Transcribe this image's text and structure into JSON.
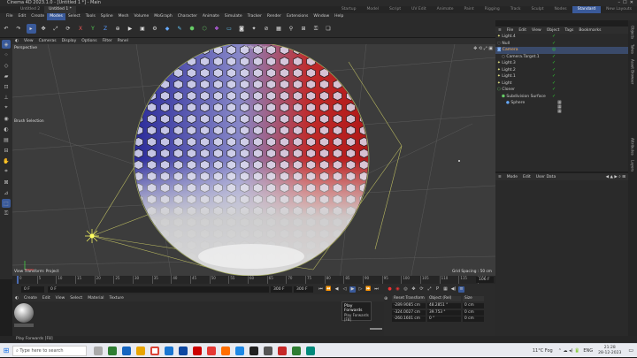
{
  "window": {
    "title": "Cinema 4D 2023.1.0 - [Untitled 1 *] - Main"
  },
  "doc_tabs": [
    "Untitled 2",
    "Untitled 1 *"
  ],
  "layouts": [
    "Startup",
    "Model",
    "Script",
    "UV Edit",
    "Animate",
    "Paint",
    "Rigging",
    "Track",
    "Sculpt",
    "Nodes",
    "Standard"
  ],
  "new_layouts": "New Layouts",
  "menus": [
    "File",
    "Edit",
    "Create",
    "Modes",
    "Select",
    "Tools",
    "Spline",
    "Mesh",
    "Volume",
    "MoGraph",
    "Character",
    "Animate",
    "Simulate",
    "Tracker",
    "Render",
    "Extensions",
    "Window",
    "Help"
  ],
  "viewport": {
    "menus": [
      "View",
      "Cameras",
      "Display",
      "Options",
      "Filter",
      "Panel"
    ],
    "name": "Perspective",
    "camera": "Default Camera",
    "tool_label": "Brush Selection",
    "status_left": "View Transform: Project",
    "grid_spacing": "Grid Spacing : 50 cm"
  },
  "timeline": {
    "ticks": [
      "0",
      "5",
      "10",
      "15",
      "20",
      "25",
      "30",
      "35",
      "40",
      "45",
      "50",
      "55",
      "60",
      "65",
      "70",
      "75",
      "80",
      "85",
      "90",
      "95",
      "100",
      "105",
      "110",
      "115",
      "120"
    ],
    "current": "0 F",
    "start": "0 F",
    "end": "300 F",
    "end2": "300 F",
    "frame_right": "106 F"
  },
  "materials": {
    "menus": [
      "Create",
      "Edit",
      "View",
      "Select",
      "Material",
      "Texture"
    ]
  },
  "tooltip": {
    "title": "Play Forwards",
    "desc": "Play Forwards",
    "key": "[F8]"
  },
  "coords": {
    "headers": [
      "Reset Transform",
      "Object (Rel)",
      "Size"
    ],
    "rows": [
      {
        "pos": "-289.9085 cm",
        "rot": "48.2851 °",
        "size": "0 cm"
      },
      {
        "pos": "-324.0027 cm",
        "rot": "39.753 °",
        "size": "0 cm"
      },
      {
        "pos": "-260.1601 cm",
        "rot": "0 °",
        "size": "0 cm"
      }
    ]
  },
  "objects": {
    "menus": [
      "File",
      "Edit",
      "View",
      "Object",
      "Tags",
      "Bookmarks"
    ],
    "items": [
      "Light.4",
      "Null",
      "Camera",
      "Camera.Target.1",
      "Light.3",
      "Light.2",
      "Light.1",
      "Light",
      "Cloner",
      "Subdivision Surface",
      "Sphere"
    ]
  },
  "attributes": {
    "menus": [
      "Mode",
      "Edit",
      "User Data"
    ]
  },
  "side_tabs": [
    "Objects",
    "Takes",
    "Asset Browser",
    "Layers",
    "Attributes"
  ],
  "status": "Play Forwards [F8]",
  "taskbar": {
    "search": "Type here to search",
    "weather": "11°C Fog",
    "lang": "ENG",
    "time": "21:28",
    "date": "28-12-2023"
  },
  "colors": {
    "accent": "#3a5a9a",
    "sphere_blue": "#3030a0",
    "sphere_red": "#c02020"
  }
}
